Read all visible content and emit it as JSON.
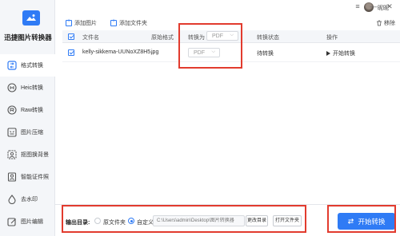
{
  "app": {
    "title": "迅捷图片转换器"
  },
  "topbar": {
    "username": "昵昵",
    "controls": [
      "≡",
      "—",
      "✕"
    ]
  },
  "sidebar": {
    "items": [
      {
        "label": "格式转换",
        "icon": "convert-icon",
        "active": true
      },
      {
        "label": "Heic转换",
        "icon": "heic-icon",
        "active": false
      },
      {
        "label": "Raw转换",
        "icon": "raw-icon",
        "active": false
      },
      {
        "label": "图片压缩",
        "icon": "compress-icon",
        "active": false
      },
      {
        "label": "抠图换背景",
        "icon": "cutout-icon",
        "active": false
      },
      {
        "label": "智能证件照",
        "icon": "id-photo-icon",
        "active": false
      },
      {
        "label": "去水印",
        "icon": "watermark-icon",
        "active": false
      },
      {
        "label": "图片编辑",
        "icon": "edit-icon",
        "active": false
      }
    ]
  },
  "toolbar": {
    "add_image": "添加图片",
    "add_folder": "添加文件夹",
    "remove": "移除"
  },
  "table": {
    "columns": [
      "文件名",
      "原始格式",
      "转换为",
      "转换状态",
      "操作"
    ],
    "header_convert_value": "PDF",
    "rows": [
      {
        "filename": "kelly-sikkema-UUNoXZ8H5...",
        "format": "jpg",
        "convert_to": "PDF",
        "status": "待转换",
        "action": "开始转换"
      }
    ]
  },
  "output": {
    "label": "输出目录:",
    "option_source": "原文件夹",
    "option_custom": "自定义",
    "path_placeholder": "C:\\Users\\admin\\Desktop\\图片转换器",
    "change_dir": "更改目录",
    "open_folder": "打开文件夹"
  },
  "start_button": "开始转换",
  "colors": {
    "accent": "#2f7bf5",
    "highlight": "#e23b2e"
  }
}
